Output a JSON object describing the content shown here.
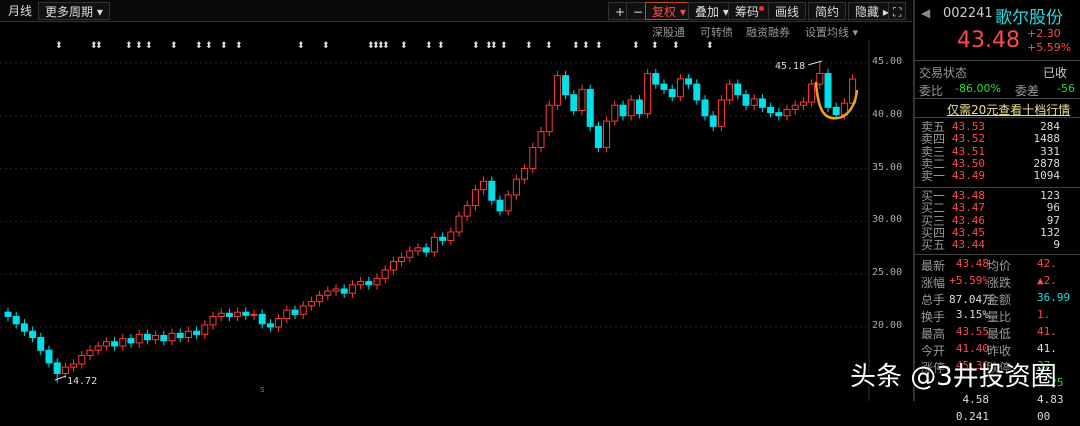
{
  "toolbar": {
    "monthly": "月线",
    "more_periods": "更多周期 ▾",
    "plus": "+",
    "minus": "−",
    "fq": "复权 ▾",
    "overlay": "叠加 ▾",
    "chips": "筹码",
    "draw": "画线",
    "simple": "简约",
    "hide": "隐藏 ▸▸",
    "expand": "⛶"
  },
  "subbar": {
    "hk_connect": "深股通",
    "convertible": "可转债",
    "margin": "融资融券",
    "ma_settings": "设置均线 ▾"
  },
  "stock": {
    "code": "002241",
    "name": "歌尔股份",
    "price": "43.48",
    "change": "+2.30",
    "change_pct": "+5.59%"
  },
  "status": {
    "trade_status_label": "交易状态",
    "trade_status_value": "已收",
    "weibi_label": "委比",
    "weibi": "-86.00%",
    "weicha_label": "委差",
    "weicha": "-56",
    "promo": "仅需20元查看十档行情"
  },
  "asks": [
    {
      "label": "卖五",
      "price": "43.53",
      "vol": "284"
    },
    {
      "label": "卖四",
      "price": "43.52",
      "vol": "1488"
    },
    {
      "label": "卖三",
      "price": "43.51",
      "vol": "331"
    },
    {
      "label": "卖二",
      "price": "43.50",
      "vol": "2878"
    },
    {
      "label": "卖一",
      "price": "43.49",
      "vol": "1094"
    }
  ],
  "bids": [
    {
      "label": "买一",
      "price": "43.48",
      "vol": "123"
    },
    {
      "label": "买二",
      "price": "43.47",
      "vol": "96"
    },
    {
      "label": "买三",
      "price": "43.46",
      "vol": "97"
    },
    {
      "label": "买四",
      "price": "43.45",
      "vol": "132"
    },
    {
      "label": "买五",
      "price": "43.44",
      "vol": "9"
    }
  ],
  "stats": [
    {
      "l1": "最新",
      "v1": "43.48",
      "c1": "red",
      "l2": "均价",
      "v2": "42.",
      "c2": "red"
    },
    {
      "l1": "涨幅",
      "v1": "+5.59%",
      "c1": "red",
      "l2": "涨跌",
      "v2": "▲2.",
      "c2": "red"
    },
    {
      "l1": "总手",
      "v1": "87.04万",
      "c1": "white",
      "l2": "金额",
      "v2": "36.99",
      "c2": "cyan"
    },
    {
      "l1": "换手",
      "v1": "3.15%",
      "c1": "white",
      "l2": "量比",
      "v2": "1.",
      "c2": "red"
    },
    {
      "l1": "最高",
      "v1": "43.55",
      "c1": "red",
      "l2": "最低",
      "v2": "41.",
      "c2": "red"
    },
    {
      "l1": "今开",
      "v1": "41.40",
      "c1": "red",
      "l2": "昨收",
      "v2": "41.",
      "c2": "white"
    },
    {
      "l1": "涨停",
      "v1": "45.30",
      "c1": "red",
      "l2": "跌停",
      "v2": "37.",
      "c2": "green"
    },
    {
      "l1": "",
      "v1": "",
      "c1": "red",
      "l2": "",
      "v2": "1.25",
      "c2": "green"
    },
    {
      "l1": "",
      "v1": "4.58",
      "c1": "white",
      "l2": "",
      "v2": "4.83",
      "c2": "white"
    },
    {
      "l1": "",
      "v1": "0.241",
      "c1": "white",
      "l2": "",
      "v2": "00",
      "c2": "white"
    }
  ],
  "chart_data": {
    "type": "candlestick",
    "y_ticks": [
      "45.00",
      "40.00",
      "35.00",
      "30.00",
      "25.00",
      "20.00"
    ],
    "ylim": [
      13.5,
      47.5
    ],
    "high_label": "45.18",
    "low_label": "14.72",
    "closes": [
      21.0,
      20.3,
      19.6,
      19.0,
      17.8,
      16.6,
      15.6,
      16.2,
      16.5,
      17.3,
      17.8,
      18.2,
      18.6,
      18.2,
      18.9,
      18.5,
      19.3,
      18.8,
      19.2,
      18.7,
      19.4,
      19.0,
      19.6,
      19.3,
      20.2,
      21.0,
      21.3,
      21.0,
      21.4,
      21.1,
      21.2,
      20.3,
      20.0,
      20.8,
      21.6,
      21.2,
      22.0,
      22.4,
      23.0,
      23.4,
      23.6,
      23.2,
      24.0,
      24.3,
      24.0,
      24.6,
      25.4,
      26.2,
      26.6,
      27.2,
      27.5,
      27.1,
      28.5,
      28.2,
      29.0,
      30.5,
      31.5,
      33.0,
      33.8,
      32.0,
      31.0,
      32.5,
      34.0,
      35.0,
      37.0,
      38.5,
      41.0,
      43.8,
      42.0,
      40.5,
      42.5,
      39.0,
      37.0,
      39.5,
      41.0,
      40.0,
      41.5,
      40.2,
      44.0,
      43.0,
      42.5,
      41.8,
      43.5,
      43.0,
      41.5,
      40.0,
      39.0,
      41.5,
      43.0,
      42.0,
      41.0,
      41.6,
      40.8,
      40.3,
      40.0,
      40.6,
      41.0,
      41.3,
      43.0,
      44.0,
      40.8,
      40.1,
      41.2,
      43.48
    ],
    "up_color": "#ff3b3b",
    "down_color": "#00e0e8"
  },
  "watermark": "头条 @3井投资圈"
}
